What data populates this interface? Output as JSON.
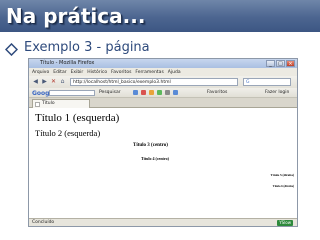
{
  "slide": {
    "title": "Na prática...",
    "bullet": "Exemplo 3 - página"
  },
  "browser": {
    "window_title": "Título - Mozilla Firefox",
    "window_buttons": [
      "_",
      "□",
      "×"
    ],
    "menu": [
      "Arquivo",
      "Editar",
      "Exibir",
      "Histórico",
      "Favoritos",
      "Ferramentas",
      "Ajuda"
    ],
    "nav": {
      "back": "◀",
      "forward": "▶",
      "stop": "✕",
      "home": "⌂",
      "url": "http://localhost/html_basico/exemplo3.html",
      "search_engine": "G"
    },
    "google_toolbar": {
      "logo": "Google",
      "search_button": "Pesquisar",
      "favorites": "Favoritos",
      "login": "Fazer login"
    },
    "tab_label": "Título",
    "page": {
      "h1": "Título 1 (esquerda)",
      "h2": "Título 2 (esquerda)",
      "h3": "Título 3 (centro)",
      "h4": "Título 4 (centro)",
      "h5": "Título 5 (direita)",
      "h6": "Título 6 (direita)"
    },
    "status": {
      "text": "Concluído",
      "badge": "YSlow"
    }
  },
  "colors": {
    "header_bar": "#4c6590",
    "title_text": "#ffffff",
    "bullet_text": "#2e4a7c",
    "bullet_marker": "#2e4a7c"
  },
  "icons": {
    "bullet": "diamond-bullet-icon",
    "window": "firefox-icon",
    "tab": "page-favicon-icon"
  }
}
